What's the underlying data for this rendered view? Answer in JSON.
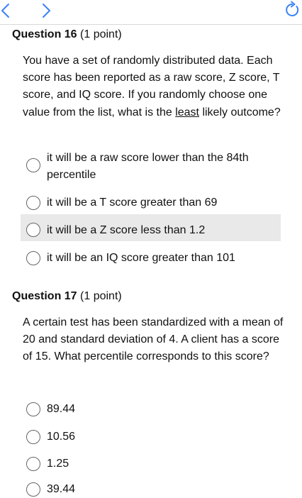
{
  "nav": {
    "back_icon": "chevron-left-icon",
    "forward_icon": "chevron-right-icon",
    "reload_icon": "reload-icon"
  },
  "questions": [
    {
      "label": "Question 16",
      "points": "(1 point)",
      "text_before": "You have a set of randomly distributed data. Each score has been reported as a raw score, Z score, T score, and IQ score. If you randomly choose one value from the list, what is the ",
      "text_emph": "least",
      "text_after": " likely outcome?",
      "options": [
        {
          "label": "it will be a raw score lower than the 84th percentile"
        },
        {
          "label": "it will be a T score greater than 69"
        },
        {
          "label": "it will be a Z score less than 1.2"
        },
        {
          "label": "it will be an IQ score greater than 101"
        }
      ]
    },
    {
      "label": "Question 17",
      "points": "(1 point)",
      "text": "A certain test has been standardized with a mean of 20 and standard deviation of 4. A client has a score of 15. What percentile corresponds to this score?",
      "options": [
        {
          "label": "89.44"
        },
        {
          "label": "10.56"
        },
        {
          "label": "1.25"
        },
        {
          "label": "39.44"
        }
      ]
    }
  ],
  "colors": {
    "icon": "#3b82f6",
    "highlight": "#e9e9e9",
    "radio_border": "#666666",
    "divider": "#d9d9d9"
  }
}
